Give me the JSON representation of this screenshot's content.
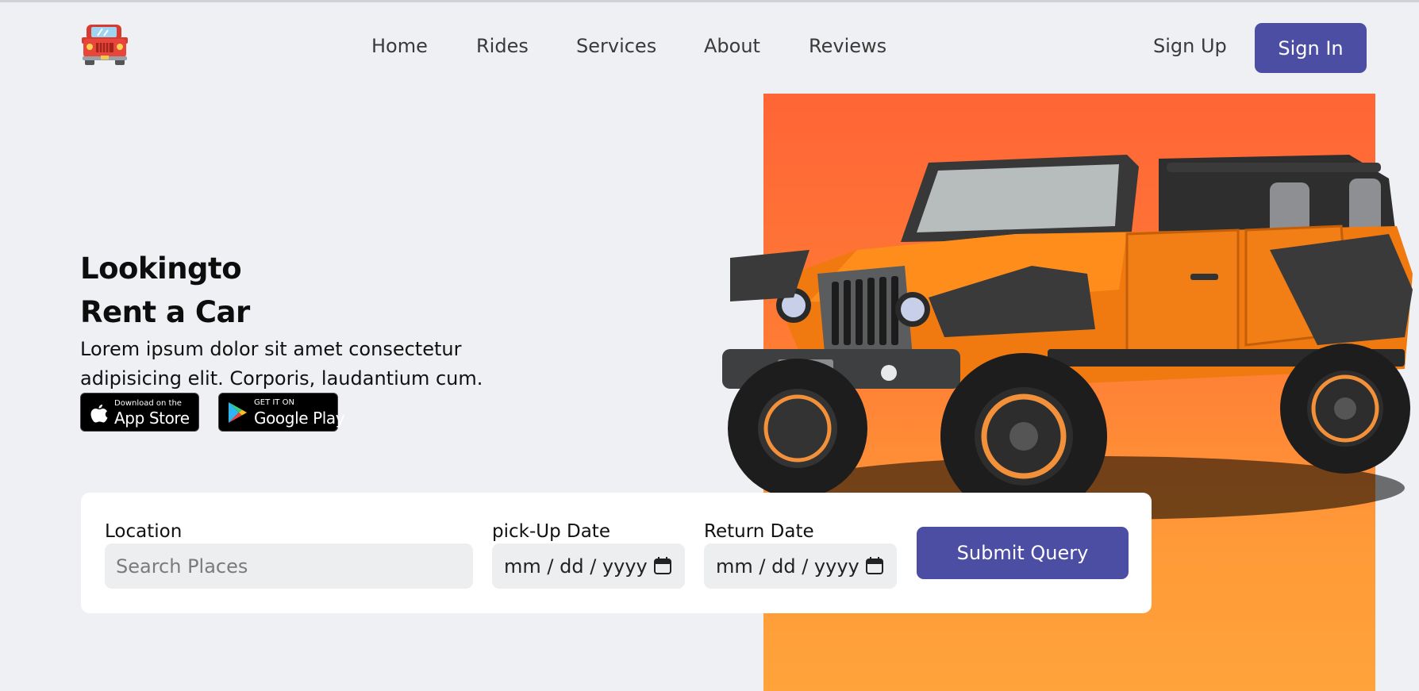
{
  "brand": {
    "logo_icon": "red-car-icon"
  },
  "nav": {
    "items": [
      "Home",
      "Rides",
      "Services",
      "About",
      "Reviews"
    ]
  },
  "auth": {
    "signup_label": "Sign Up",
    "signin_label": "Sign In"
  },
  "hero": {
    "title_line1": "Lookingto",
    "title_line2": "Rent a Car",
    "description": "Lorem ipsum dolor sit amet consectetur adipisicing elit. Corporis, laudantium cum.",
    "app_store": {
      "small": "Download on the",
      "big": "App Store",
      "icon": "apple-icon"
    },
    "google_play": {
      "small": "GET IT ON",
      "big": "Google Play",
      "icon": "google-play-icon"
    },
    "image": "orange-jeep"
  },
  "booking": {
    "location_label": "Location",
    "location_placeholder": "Search Places",
    "pickup_label": "pick-Up Date",
    "pickup_value": "mm / dd / yyyy",
    "return_label": "Return Date",
    "return_value": "mm / dd / yyyy",
    "submit_label": "Submit Query"
  },
  "colors": {
    "primary": "#4b4ea3",
    "accent_orange": "#ff6536",
    "background": "#eef0f3"
  }
}
